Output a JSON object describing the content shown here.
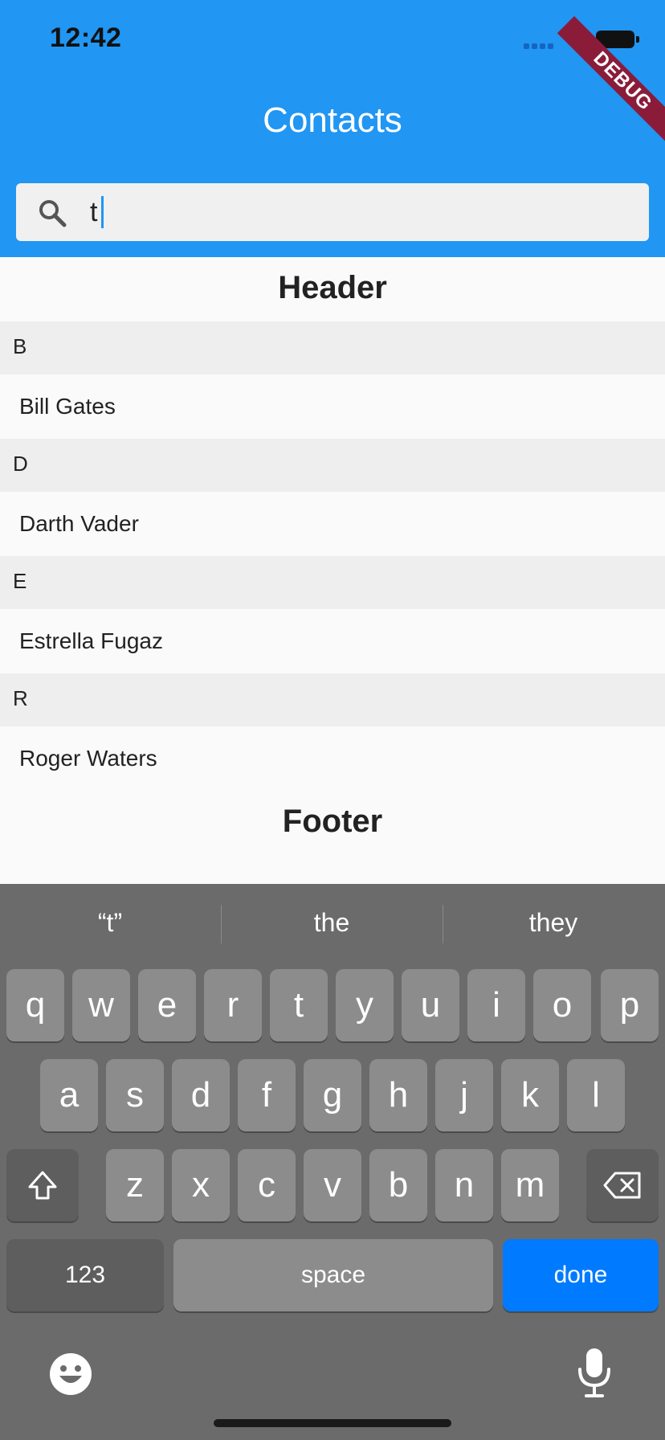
{
  "status_bar": {
    "time": "12:42"
  },
  "debug_banner": "DEBUG",
  "app_bar": {
    "title": "Contacts"
  },
  "search": {
    "value": "t",
    "placeholder": ""
  },
  "list": {
    "header": "Header",
    "footer": "Footer",
    "sections": [
      {
        "letter": "B",
        "contacts": [
          "Bill Gates"
        ]
      },
      {
        "letter": "D",
        "contacts": [
          "Darth Vader"
        ]
      },
      {
        "letter": "E",
        "contacts": [
          "Estrella Fugaz"
        ]
      },
      {
        "letter": "R",
        "contacts": [
          "Roger Waters"
        ]
      }
    ]
  },
  "keyboard": {
    "suggestions": [
      "“t”",
      "the",
      "they"
    ],
    "row1": [
      "q",
      "w",
      "e",
      "r",
      "t",
      "y",
      "u",
      "i",
      "o",
      "p"
    ],
    "row2": [
      "a",
      "s",
      "d",
      "f",
      "g",
      "h",
      "j",
      "k",
      "l"
    ],
    "row3": [
      "z",
      "x",
      "c",
      "v",
      "b",
      "n",
      "m"
    ],
    "numbers_label": "123",
    "space_label": "space",
    "done_label": "done"
  },
  "colors": {
    "app_bar": "#2196f3",
    "done_key": "#007aff",
    "keyboard_bg": "#6b6b6b"
  }
}
